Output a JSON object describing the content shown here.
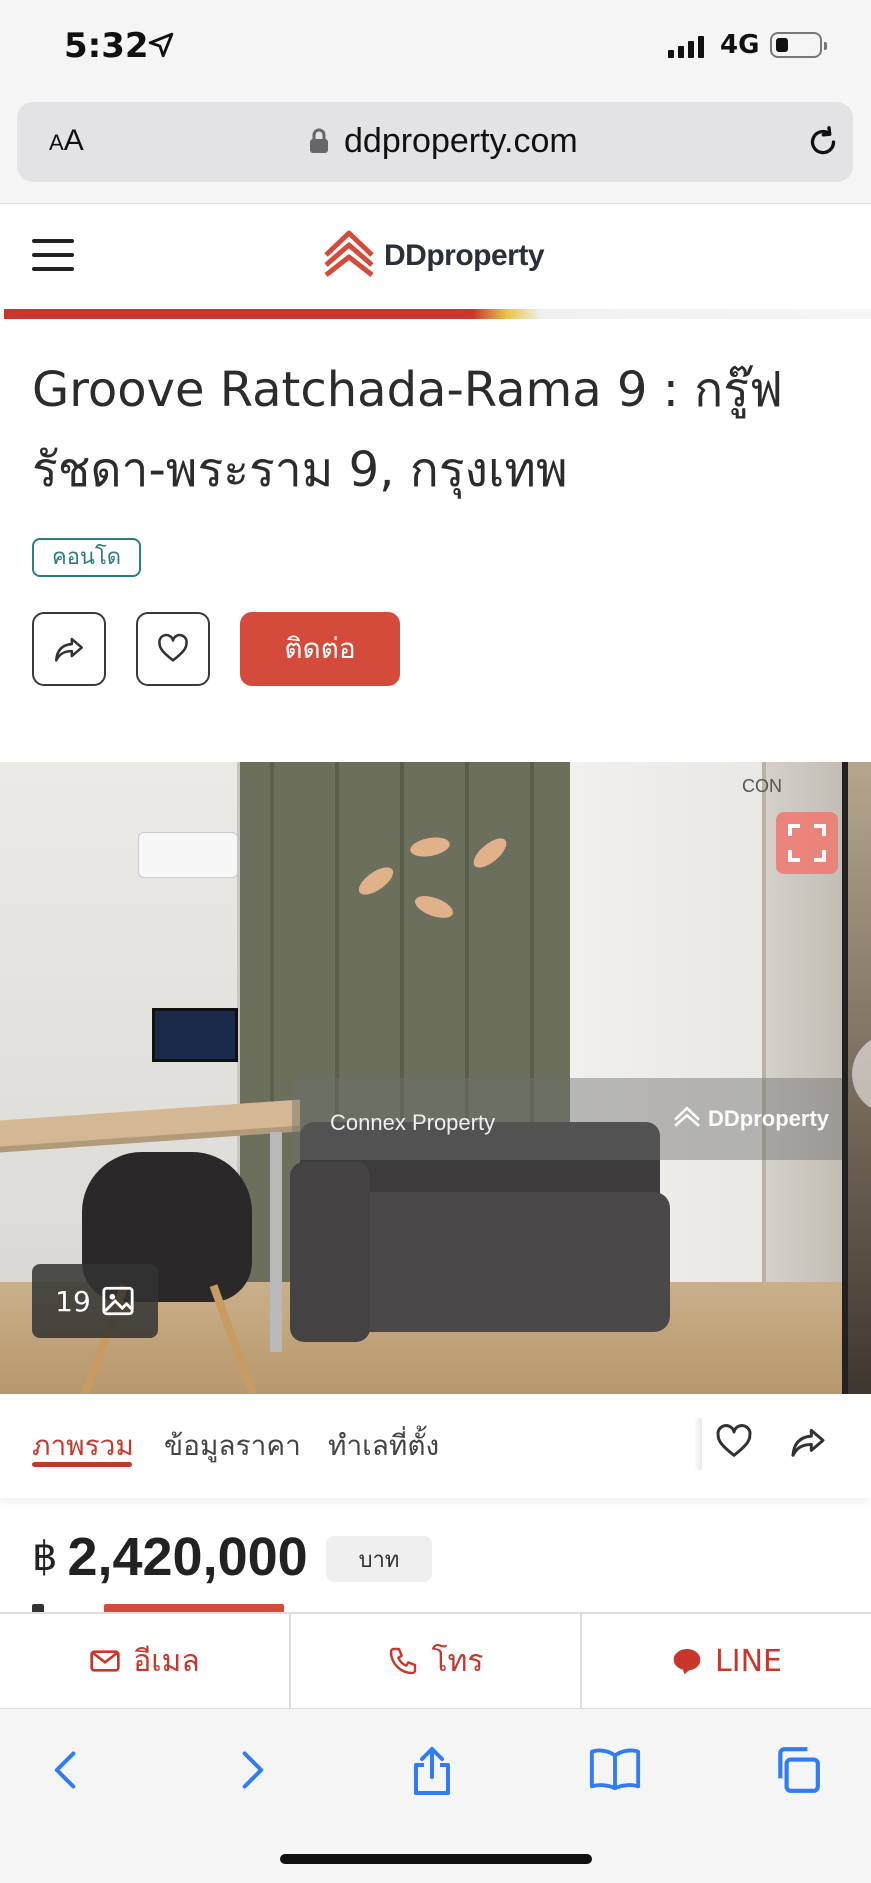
{
  "status_bar": {
    "time": "5:32",
    "network": "4G"
  },
  "browser": {
    "text_size_label": "AA",
    "url": "ddproperty.com"
  },
  "site": {
    "brand": "DDproperty"
  },
  "listing": {
    "title": "Groove Ratchada-Rama 9 : กรู๊ฟ รัชดา-พระราม 9, กรุงเทพ",
    "type_badge": "คอนโด",
    "contact_label": "ติดต่อ",
    "photo_count": "19",
    "watermark_agent": "Connex Property",
    "watermark_brand": "DDproperty",
    "agent_logo_text": "CON"
  },
  "tabs": [
    {
      "label": "ภาพรวม",
      "active": true
    },
    {
      "label": "ข้อมูลราคา",
      "active": false
    },
    {
      "label": "ทำเลที่ตั้ง",
      "active": false
    }
  ],
  "price": {
    "currency": "฿",
    "amount": "2,420,000",
    "unit": "บาท"
  },
  "contact_bar": {
    "email": "อีเมล",
    "phone": "โทร",
    "line": "LINE"
  },
  "colors": {
    "brand_red": "#c8372c",
    "badge_teal": "#2b7d80",
    "safari_blue": "#2f7cf6"
  },
  "icons": [
    "location-arrow-icon",
    "lock-icon",
    "reload-icon",
    "hamburger-icon",
    "share-icon",
    "heart-icon",
    "expand-icon",
    "gallery-icon",
    "email-icon",
    "phone-icon",
    "line-icon",
    "back-icon",
    "forward-icon",
    "share-sheet-icon",
    "bookmarks-icon",
    "tabs-icon"
  ]
}
